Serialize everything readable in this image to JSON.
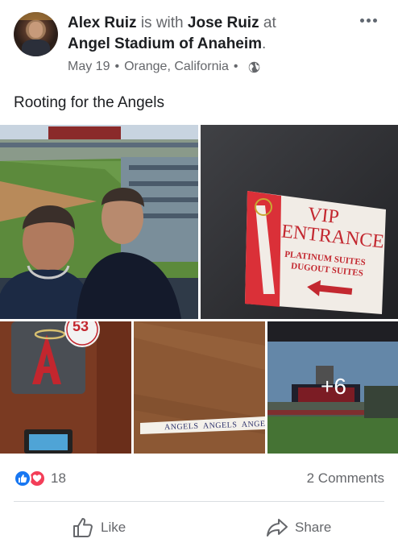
{
  "header": {
    "author": "Alex Ruiz",
    "with_text": "is with",
    "tagged": "Jose Ruiz",
    "at_text": "at",
    "place": "Angel Stadium of Anaheim",
    "place_suffix": ".",
    "date": "May 19",
    "separator": "•",
    "location": "Orange, California",
    "privacy_icon": "globe-icon",
    "more_icon": "more-options-icon"
  },
  "post": {
    "caption": "Rooting for the Angels"
  },
  "photos": {
    "more_count": "+6",
    "wristband_text": "ANGELS  ANGELS  ANGEL",
    "sign_line1": "VIP",
    "sign_line2": "ENTRANCE",
    "sign_line3": "PLATINUM SUITES",
    "sign_line4": "DUGOUT SUITES",
    "jersey_number": "53"
  },
  "reactions": {
    "count": "18",
    "icons": [
      "like-reaction-icon",
      "love-reaction-icon"
    ],
    "comments": "2 Comments"
  },
  "actions": {
    "like_label": "Like",
    "share_label": "Share"
  },
  "colors": {
    "text": "#1c1e21",
    "muted": "#65676b",
    "like_blue": "#1877f2",
    "love_red": "#f33e58",
    "divider": "#dadde1"
  }
}
